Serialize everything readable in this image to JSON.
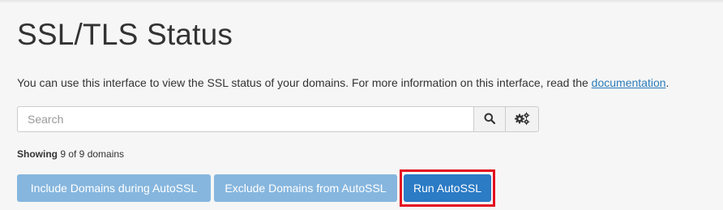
{
  "page": {
    "title": "SSL/TLS Status",
    "intro_text": "You can use this interface to view the SSL status of your domains. For more information on this interface, read the ",
    "intro_link": "documentation",
    "intro_suffix": "."
  },
  "search": {
    "placeholder": "Search",
    "value": "",
    "search_icon": "search-icon",
    "settings_icon": "gears-icon"
  },
  "status": {
    "showing_label": "Showing",
    "showing_text": " 9 of 9 domains"
  },
  "actions": {
    "include_label": "Include Domains during AutoSSL",
    "exclude_label": "Exclude Domains from AutoSSL",
    "run_label": "Run AutoSSL"
  },
  "colors": {
    "primary": "#2b7bc5",
    "primary_disabled": "#86b6de",
    "link": "#2b7bb9",
    "highlight": "#e3101f"
  }
}
